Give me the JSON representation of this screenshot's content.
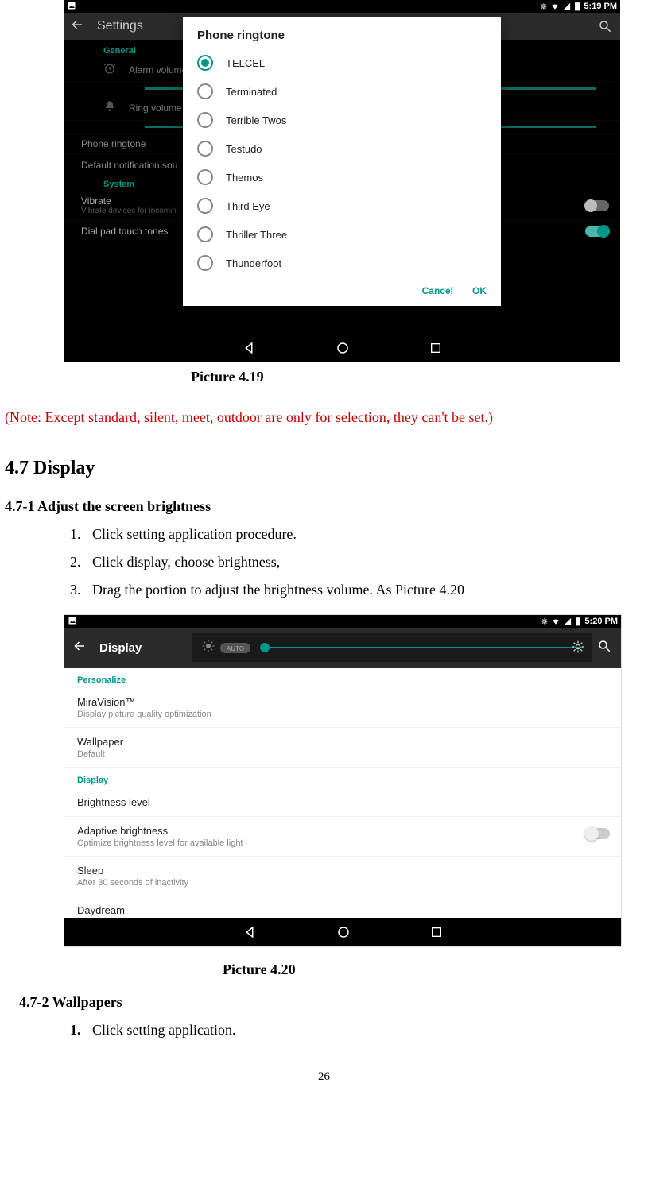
{
  "screenshot1": {
    "status_time": "5:19 PM",
    "settings_title": "Settings",
    "section_general": "General",
    "alarm_label": "Alarm volume",
    "ring_label": "Ring volume",
    "phone_ringtone_row": "Phone ringtone",
    "default_notification_row": "Default notification sou",
    "section_system": "System",
    "vibrate_label": "Vibrate",
    "vibrate_sub": "Vibrate devices for incomin",
    "dialpad_label": "Dial pad touch tones",
    "dialog_title": "Phone ringtone",
    "options": [
      "TELCEL",
      "Terminated",
      "Terrible Twos",
      "Testudo",
      "Themos",
      "Third Eye",
      "Thriller Three",
      "Thunderfoot"
    ],
    "cancel": "Cancel",
    "ok": "OK"
  },
  "caption1": "Picture 4.19",
  "note": "(Note: Except standard, silent, meet, outdoor are only for selection, they can't be set.)",
  "heading": "4.7 Display",
  "sub1": "4.7-1 Adjust the screen brightness",
  "step1": "Click setting application procedure.",
  "step2": "Click display, choose brightness,",
  "step3": "Drag the portion to adjust the brightness volume. As Picture 4.20",
  "screenshot2": {
    "status_time": "5:20 PM",
    "title": "Display",
    "auto": "AUTO",
    "section_personalize": "Personalize",
    "mira_title": "MiraVision™",
    "mira_sub": "Display picture quality optimization",
    "wallpaper_title": "Wallpaper",
    "wallpaper_sub": "Default",
    "section_display": "Display",
    "brightness_level": "Brightness level",
    "adaptive_title": "Adaptive brightness",
    "adaptive_sub": "Optimize brightness level for available light",
    "sleep_title": "Sleep",
    "sleep_sub": "After 30 seconds of inactivity",
    "daydream": "Daydream"
  },
  "caption2": "Picture 4.20",
  "sub2": "4.7-2    Wallpapers",
  "step2_1": "Click setting application.",
  "pagenum": "26"
}
